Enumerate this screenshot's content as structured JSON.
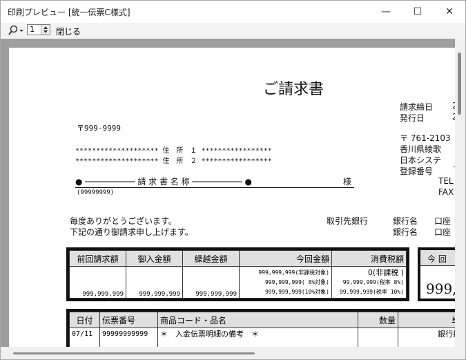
{
  "window": {
    "title": "印刷プレビュー [統一伝票C様式]"
  },
  "titlebar_buttons": {
    "minimize": "—",
    "maximize": "☐",
    "close": "✕"
  },
  "toolbar": {
    "zoom_icon": "magnifier-icon",
    "page_value": "1",
    "close_label": "閉じる"
  },
  "doc": {
    "title": "ご請求書",
    "close_date_label": "請求締日",
    "close_date_value": "2",
    "issue_date_label": "発行日",
    "issue_date_value": "2",
    "postal": "〒999-9999",
    "address1": "******************** 住　所　１ *****************",
    "address2": "******************** 住　所　２ *****************",
    "recipient_name": "● ────────── 請 求 書 名 称 ────────── ●",
    "honorific": "様",
    "recipient_code": "(99999999)",
    "sender_postal": "〒 761-2103",
    "sender_addr": "香川県綾歌",
    "sender_company": "日本システ",
    "reg_no_label": "登録番号",
    "reg_no_value": "T",
    "tel": "TEL",
    "fax": "FAX",
    "greeting1": "毎度ありがとうございます。",
    "greeting2": "下記の通り御請求申し上げます。",
    "bank_label": "取引先銀行",
    "bank_name_label1": "銀行名",
    "bank_account1": "口座",
    "bank_name_label2": "銀行名",
    "bank_account2": "口座"
  },
  "summary": {
    "headers": [
      "前回請求額",
      "御入金額",
      "繰越金額",
      "今回金額",
      "消費税額"
    ],
    "values": [
      "999,999,999",
      "999,999,999",
      "999,999,999"
    ],
    "current_lines": [
      "999,999,999(非課税対象)",
      "999,999,999( 8%対象)",
      "999,999,999(10%対象)"
    ],
    "tax_lines": [
      "0(非課税 )",
      "99,999,999(税率 8%)",
      "99,999,999(税率 10%)"
    ],
    "right_header": "今 回",
    "right_value": "999,"
  },
  "detail": {
    "headers": [
      "日付",
      "伝票番号",
      "商品コード・品名",
      "数量",
      "単価"
    ],
    "row": [
      "07/11",
      "99999999999",
      "＊　入金伝票明細の備考　＊",
      "",
      "銀行振込"
    ]
  }
}
